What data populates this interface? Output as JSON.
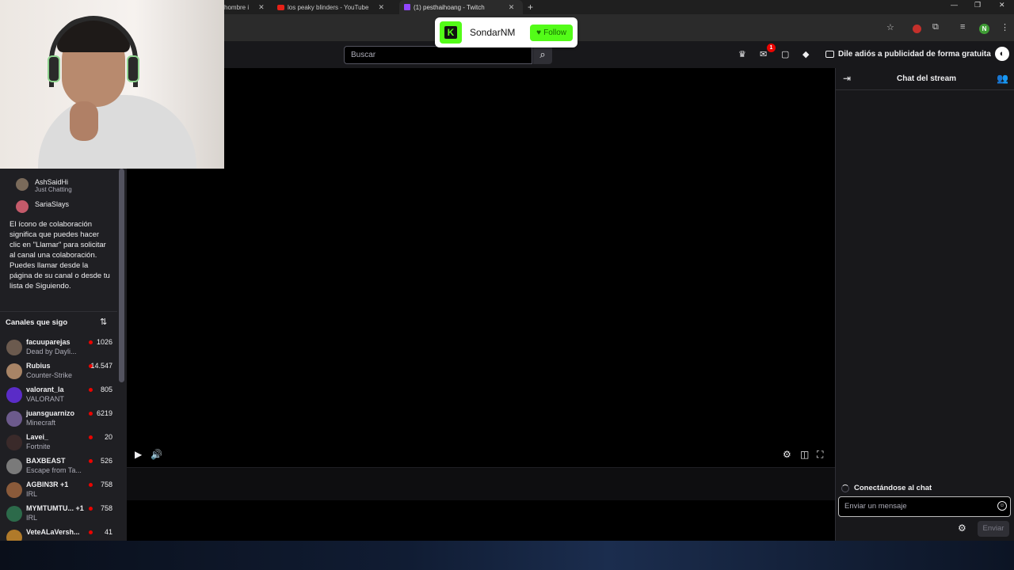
{
  "browser": {
    "tabs": [
      {
        "label": "hombre i",
        "active": false
      },
      {
        "label": "los peaky blinders - YouTube",
        "active": false
      },
      {
        "label": "(1) pesthaihoang - Twitch",
        "active": true
      }
    ],
    "profile_initial": "N"
  },
  "kick_popup": {
    "logo_letter": "K",
    "channel": "SondarNM",
    "follow_label": "Follow",
    "accent": "#53fc18"
  },
  "topnav": {
    "search_placeholder": "Buscar",
    "notification_count": "1",
    "adfree_label": "Dile adiós a publicidad de forma gratuita"
  },
  "sidebar": {
    "recommended": [
      {
        "name": "AshSaidHi",
        "category": "Just Chatting"
      },
      {
        "name": "SariaSlays",
        "category": ""
      }
    ],
    "tip": "El ícono de colaboración significa que puedes hacer clic en \"Llamar\" para solicitar al canal una colaboración. Puedes llamar desde la página de su canal o desde tu lista de Siguiendo.",
    "followed_heading": "Canales que sigo",
    "channels": [
      {
        "name": "facuuparejas",
        "game": "Dead by Dayli...",
        "viewers": "1026",
        "color": "#6b5a4e"
      },
      {
        "name": "Rubius",
        "game": "Counter-Strike",
        "viewers": "14.547",
        "color": "#a88466"
      },
      {
        "name": "valorant_la",
        "game": "VALORANT",
        "viewers": "805",
        "color": "#5a2cc7"
      },
      {
        "name": "juansguarnizo",
        "game": "Minecraft",
        "viewers": "6219",
        "color": "#6c5a8c"
      },
      {
        "name": "Lavei_",
        "game": "Fortnite",
        "viewers": "20",
        "color": "#3a2a2a"
      },
      {
        "name": "BAXBEAST",
        "game": "Escape from Ta...",
        "viewers": "526",
        "color": "#7a7a7a"
      },
      {
        "name": "AGBIN3R +1",
        "game": "IRL",
        "viewers": "758",
        "color": "#8a5a3a"
      },
      {
        "name": "MYMTUMTU... +1",
        "game": "IRL",
        "viewers": "758",
        "color": "#2c6a4a"
      },
      {
        "name": "VeteALaVersh...",
        "game": "",
        "viewers": "41",
        "color": "#b07a2a"
      }
    ]
  },
  "chat": {
    "title": "Chat del stream",
    "status": "Conectándose al chat",
    "input_placeholder": "Enviar un mensaje",
    "send_label": "Enviar"
  }
}
